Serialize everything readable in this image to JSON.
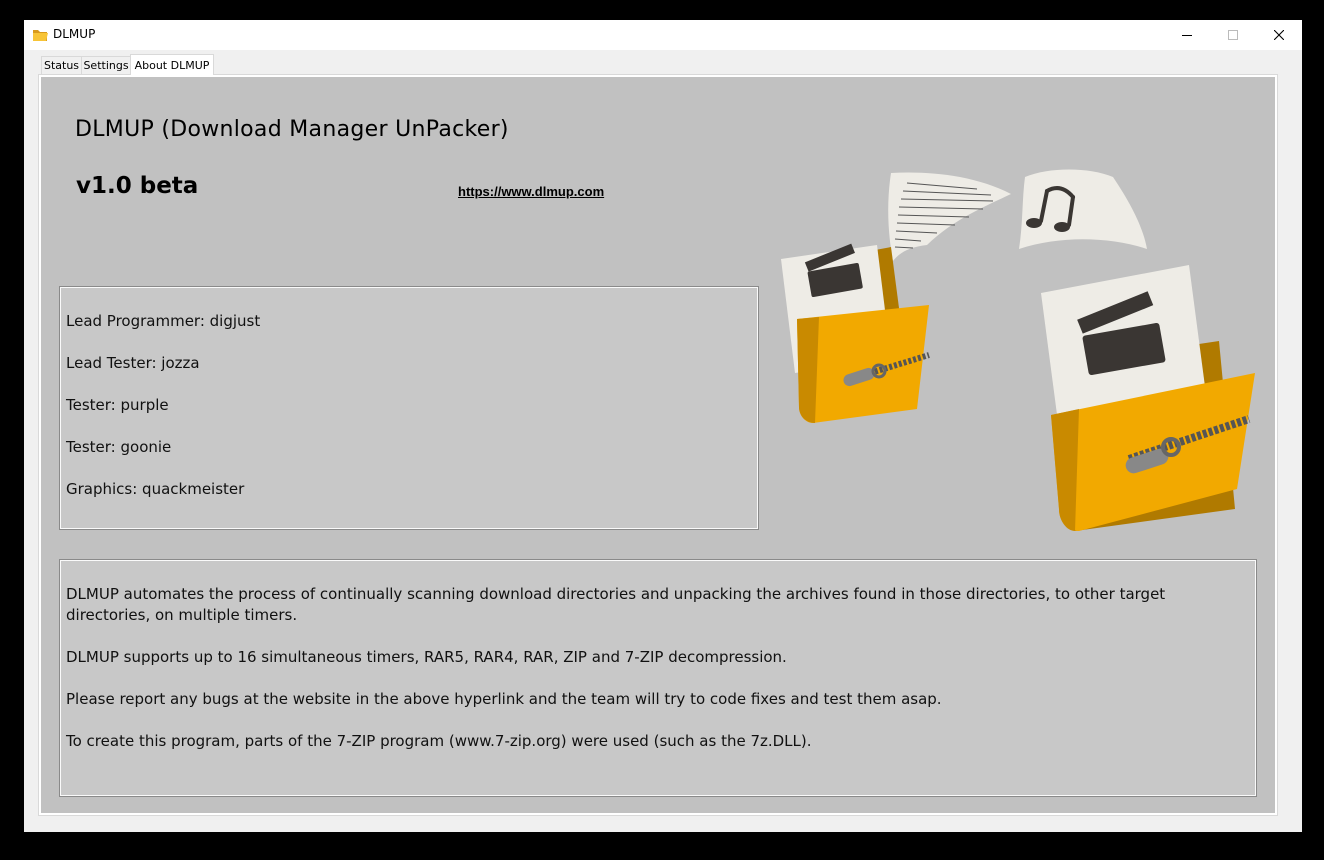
{
  "window": {
    "title": "DLMUP"
  },
  "tabs": [
    {
      "label": "Status"
    },
    {
      "label": "Settings"
    },
    {
      "label": "About DLMUP"
    }
  ],
  "about": {
    "title": "DLMUP (Download Manager UnPacker)",
    "version": "v1.0 beta",
    "website": "https://www.dlmup.com"
  },
  "credits": [
    "Lead Programmer: digjust",
    "Lead Tester: jozza",
    "Tester: purple",
    "Tester: goonie",
    "Graphics: quackmeister"
  ],
  "description": [
    "DLMUP automates the process of continually scanning download directories and unpacking the archives found in those directories, to other target directories, on multiple timers.",
    "DLMUP supports up to 16 simultaneous timers, RAR5, RAR4, RAR, ZIP and 7-ZIP decompression.",
    "Please report any bugs at the website in the above hyperlink and the team will try to code fixes and test them asap.",
    "To create this program, parts of the 7-ZIP program (www.7-zip.org) were used (such as the 7z.DLL)."
  ],
  "colors": {
    "panel_background": "#c1c1c1",
    "folder_yellow": "#f2a900",
    "folder_dark": "#b07a00",
    "paper": "#eeece6",
    "icon_dark": "#3a3633"
  }
}
